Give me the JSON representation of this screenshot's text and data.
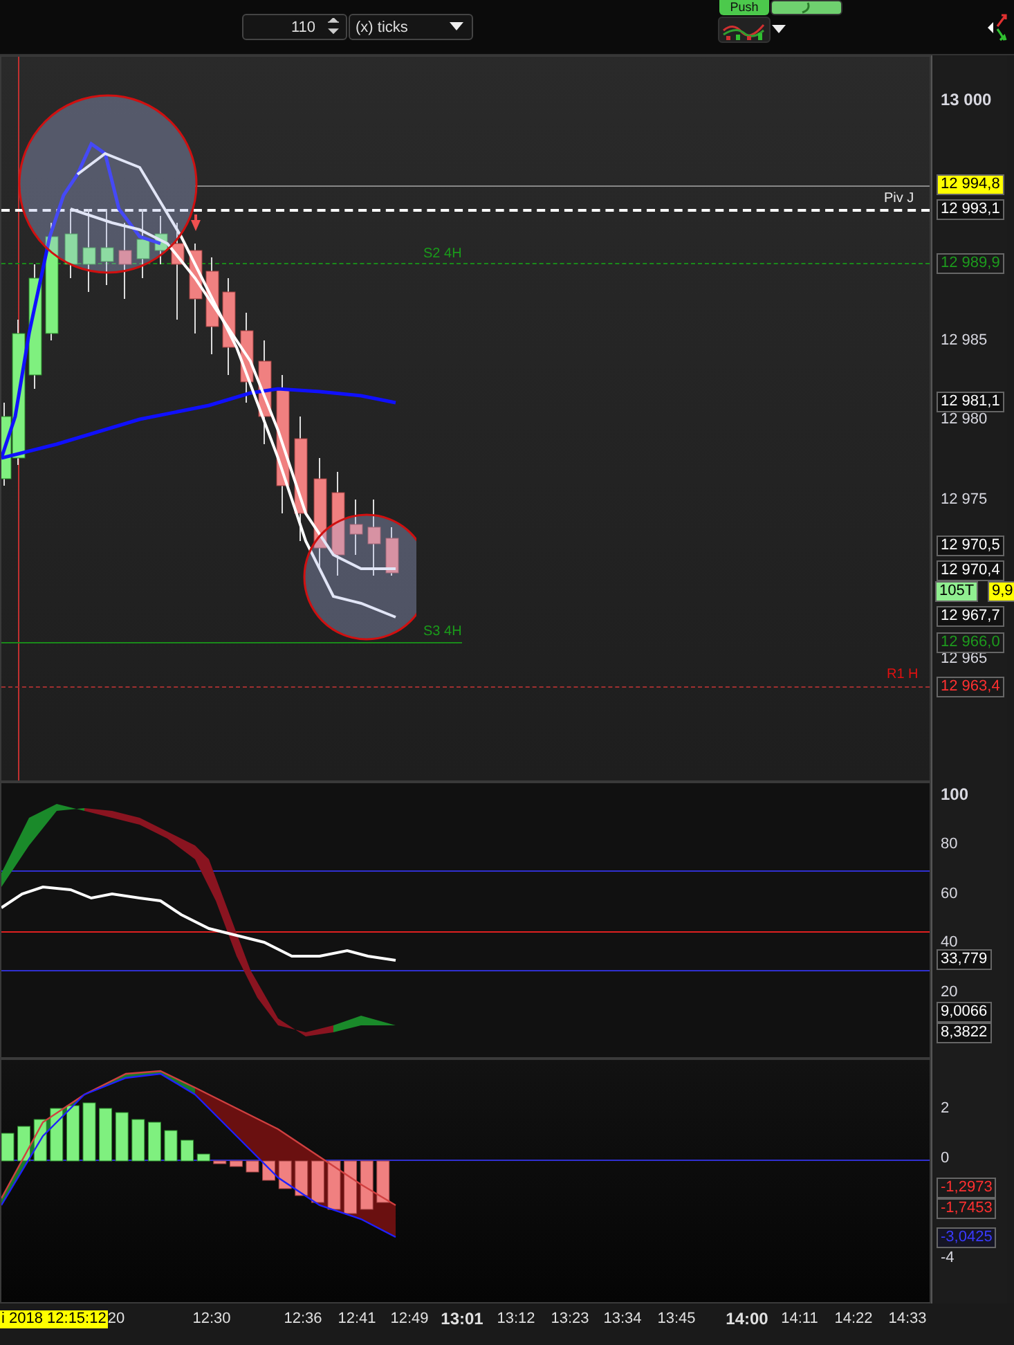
{
  "toolbar": {
    "period_value": "110",
    "unit_select": "(x) ticks",
    "push_button": "Push"
  },
  "price_pane": {
    "axis_ticks": [
      "13 000",
      "12 985",
      "12 980",
      "12 975",
      "12 965"
    ],
    "price_tags": [
      {
        "text": "12 994,8",
        "kind": "highlight"
      },
      {
        "text": "12 993,1",
        "kind": "neutral"
      },
      {
        "text": "12 989,9",
        "kind": "support"
      },
      {
        "text": "12 981,1",
        "kind": "neutral"
      },
      {
        "text": "12 970,5",
        "kind": "neutral"
      },
      {
        "text": "12 970,4",
        "kind": "neutral"
      },
      {
        "text": "105T",
        "kind": "ticks"
      },
      {
        "text": "9,9",
        "kind": "highlight"
      },
      {
        "text": "12 967,7",
        "kind": "neutral"
      },
      {
        "text": "12 966,0",
        "kind": "support"
      },
      {
        "text": "12 963,4",
        "kind": "resistance"
      }
    ],
    "line_labels": [
      {
        "text": "Piv J",
        "kind": "pivot"
      },
      {
        "text": "S2 4H",
        "kind": "support"
      },
      {
        "text": "S3 4H",
        "kind": "support"
      },
      {
        "text": "R1 H",
        "kind": "resistance"
      }
    ]
  },
  "oscillator_pane": {
    "axis_ticks": [
      "100",
      "80",
      "60",
      "40",
      "20"
    ],
    "value_tags": [
      {
        "text": "33,779",
        "kind": "neutral"
      },
      {
        "text": "9,0066",
        "kind": "neutral"
      },
      {
        "text": "8,3822",
        "kind": "neutral"
      }
    ]
  },
  "macd_pane": {
    "axis_ticks": [
      "2",
      "0",
      "-4"
    ],
    "value_tags": [
      {
        "text": "-1,2973",
        "kind": "resistance"
      },
      {
        "text": "-1,7453",
        "kind": "resistance"
      },
      {
        "text": "-3,0425",
        "kind": "signal"
      }
    ]
  },
  "time_axis": {
    "date_tag": "i 2018 12:15:12",
    "labels": [
      {
        "text": "20",
        "major": false
      },
      {
        "text": "12:30",
        "major": false
      },
      {
        "text": "12:36",
        "major": false
      },
      {
        "text": "12:41",
        "major": false
      },
      {
        "text": "12:49",
        "major": false
      },
      {
        "text": "13:01",
        "major": true
      },
      {
        "text": "13:12",
        "major": false
      },
      {
        "text": "13:23",
        "major": false
      },
      {
        "text": "13:34",
        "major": false
      },
      {
        "text": "13:45",
        "major": false
      },
      {
        "text": "14:00",
        "major": true
      },
      {
        "text": "14:11",
        "major": false
      },
      {
        "text": "14:22",
        "major": false
      },
      {
        "text": "14:33",
        "major": false
      }
    ]
  }
}
